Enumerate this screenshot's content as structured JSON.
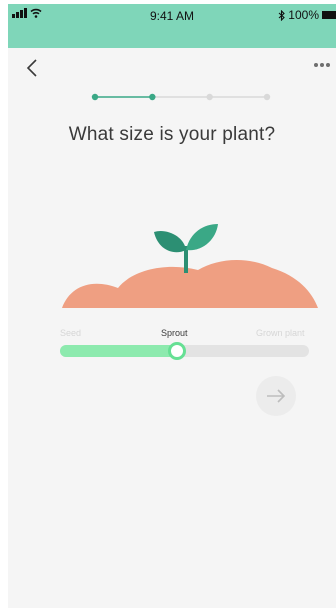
{
  "status_bar": {
    "time": "9:41 AM",
    "battery": "100%",
    "icons": [
      "signal-icon",
      "wifi-icon",
      "bluetooth-icon",
      "battery-icon"
    ]
  },
  "nav": {
    "back_icon": "chevron-left-icon",
    "more_icon": "more-dots-icon"
  },
  "onboarding": {
    "step_count": 4,
    "current_step": 2,
    "title": "What size is your plant?"
  },
  "size_slider": {
    "options": [
      "Seed",
      "Sprout",
      "Grown plant"
    ],
    "selected": "Sprout",
    "value_fraction": 0.47
  },
  "next_button": {
    "icon": "arrow-right-icon"
  },
  "colors": {
    "accent": "#7fd6b9",
    "slider_fill": "#8deaae",
    "soil": "#ef9f82",
    "leaf": "#2c8f73",
    "background": "#f5f5f5"
  }
}
